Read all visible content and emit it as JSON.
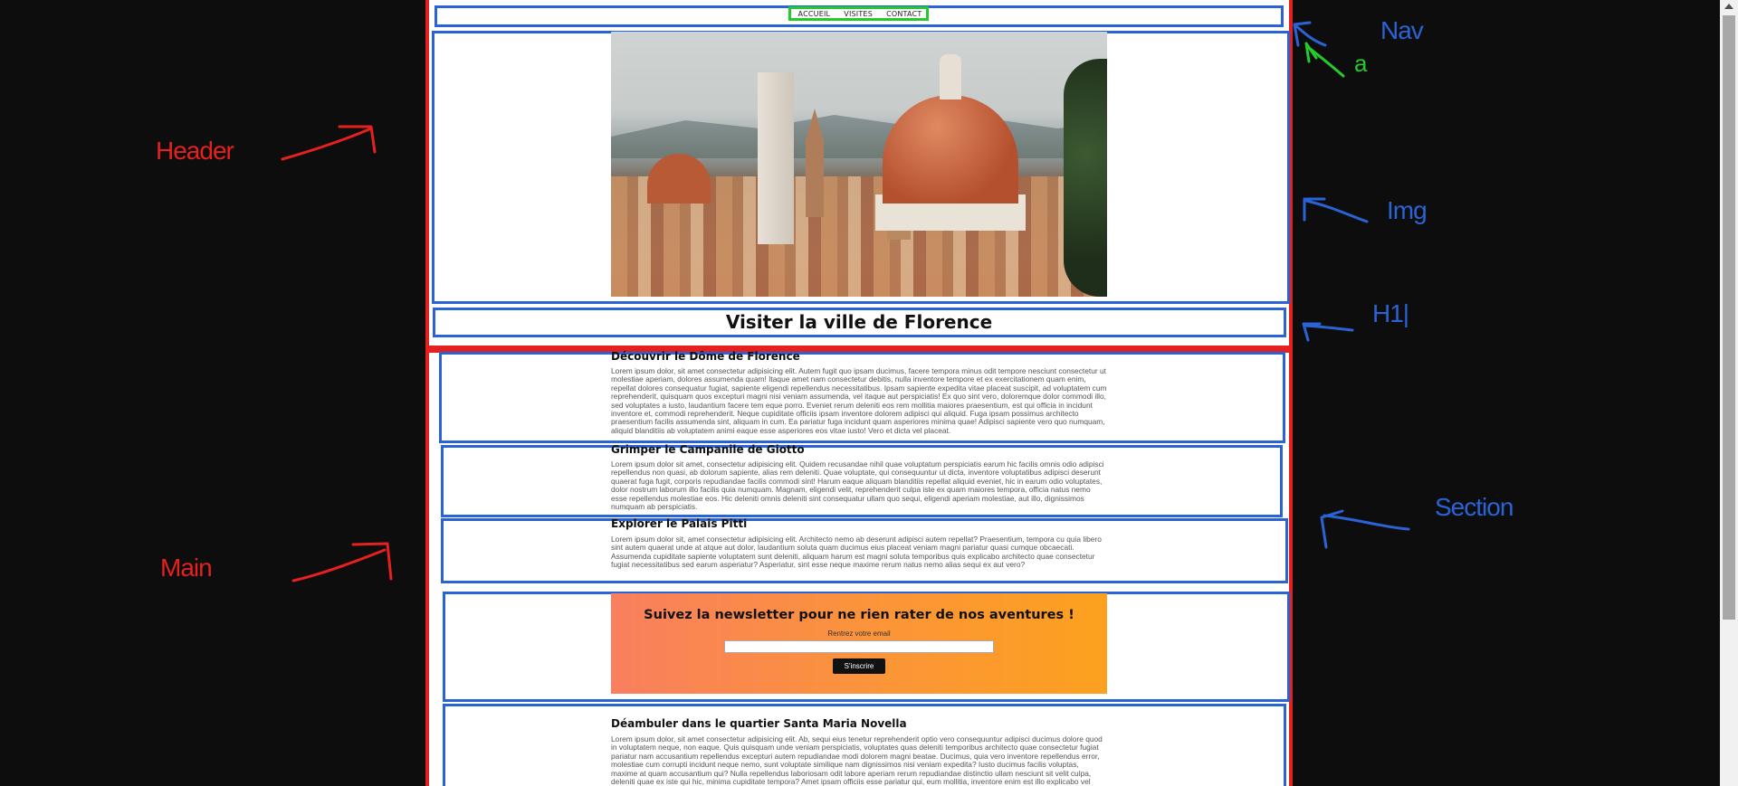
{
  "nav": {
    "items": [
      {
        "label": "ACCUEIL"
      },
      {
        "label": "VISITES"
      },
      {
        "label": "CONTACT"
      }
    ]
  },
  "header": {
    "title": "Visiter la ville de Florence"
  },
  "sections": [
    {
      "title": "Découvrir le Dôme de Florence",
      "text": "Lorem ipsum dolor, sit amet consectetur adipisicing elit. Autem fugit quo ipsam ducimus, facere tempora minus odit tempore nesciunt consectetur ut molestiae aperiam, dolores assumenda quam! Itaque amet nam consectetur debitis, nulla inventore tempore et ex exercitationem quam enim, repellat dolores consequatur fugiat, sapiente eligendi repellendus necessitatibus. Ipsam sapiente expedita vitae placeat suscipit, ad voluptatem cum reprehenderit, quisquam quos excepturi magni nisi veniam assumenda, vel itaque aut perspiciatis! Ex quo sint vero, doloremque dolor commodi illo, sed voluptates a iusto, laudantium facere tem eque porro. Eveniet rerum deleniti eos rem mollitia maiores praesentium, est qui officia in incidunt inventore et, commodi reprehenderit. Neque cupiditate officiis ipsam inventore dolorem adipisci qui aliquid. Fuga ipsam possimus architecto praesentium facilis assumenda sint, aliquam in cum. Ea pariatur fuga incidunt quam asperiores minima quae! Adipisci sapiente vero quo numquam, aliquid blanditiis ab voluptatem animi eaque esse asperiores eos vitae iusto! Vero et dicta vel placeat."
    },
    {
      "title": "Grimper le Campanile de Giotto",
      "text": "Lorem ipsum dolor sit amet, consectetur adipisicing elit. Quidem recusandae nihil quae voluptatum perspiciatis earum hic facilis omnis odio adipisci repellendus non quasi, ab dolorum sapiente, alias rem deleniti. Quae voluptate, qui consequuntur ut dicta, inventore voluptatibus adipisci deserunt quaerat fuga fugit, corporis repudiandae facilis commodi sint! Harum eaque aliquam blanditiis repellat aliquid eveniet, hic in earum odio voluptates, dolor nostrum laborum illo facilis quia numquam. Magnam, eligendi velit, reprehenderit culpa iste ex quam maiores tempora, officia natus nemo esse repellendus molestiae eos. Hic deleniti omnis deleniti sint consequatur ullam quo sequi, eligendi aperiam molestiae, aut illo, dignissimos numquam ab perspiciatis."
    },
    {
      "title": "Explorer le Palais Pitti",
      "text": "Lorem ipsum dolor sit, amet consectetur adipisicing elit. Architecto nemo ab deserunt adipisci autem repellat? Praesentium, tempora cu quia libero sint autem quaerat unde at atque aut dolor, laudantium soluta quam ducimus eius placeat veniam magni pariatur quasi cumque obcaecati. Assumenda cupiditate sapiente voluptatem sunt deleniti, aliquam harum est magni soluta temporibus quis explicabo architecto quae consectetur fugiat necessitatibus sed earum asperiatur? Asperiatur, sint esse neque maxime rerum natus nemo alias sequi ex aut vero?"
    },
    {
      "title": "Déambuler dans le quartier Santa Maria Novella",
      "text": "Lorem ipsum dolor, sit amet consectetur adipisicing elit. Ab, sequi eius tenetur reprehenderit optio vero consequuntur adipisci ducimus dolore quod in voluptatem neque, non eaque. Quis quisquam unde veniam perspiciatis, voluptates quas deleniti temporibus architecto quae consectetur fugiat pariatur nam accusantium repellendus excepturi autem repudiandae modi dolorem magni beatae. Ducimus, quia vero inventore repellendus error, molestiae cum corrupti incidunt neque nemo, sunt voluptate similique nam dignissimos nisi veniam expedita? Iusto ducimus facilis voluptas, maxime at quam accusantium qui? Nulla repellendus laboriosam odit labore aperiam rerum repudiandae distinctio ullam nesciunt sit velit culpa, deleniti quae ex iste qui hic, minima cupiditate tempora? Amet ipsam officiis esse pariatur qui, eum mollitia, inventore enim est illo explicabo vel nobis? Doloremque libero"
    }
  ],
  "newsletter": {
    "title": "Suivez la newsletter pour ne rien rater de nos aventures !",
    "label": "Rentrez votre email",
    "button": "S'inscrire"
  },
  "annotations": {
    "header": "Header",
    "main": "Main",
    "nav": "Nav",
    "a": "a",
    "img": "Img",
    "h1": "H1|",
    "section": "Section"
  },
  "colors": {
    "red": "#e5211f",
    "blue": "#2a63d6",
    "green": "#25c92a",
    "background": "#0d0d0d"
  }
}
